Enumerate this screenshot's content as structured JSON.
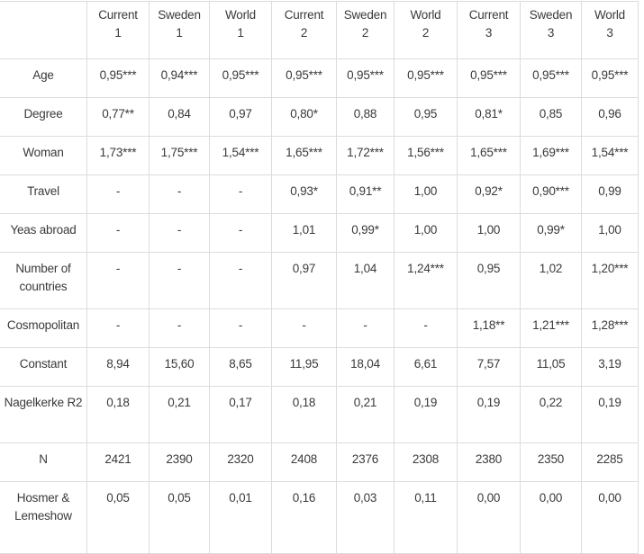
{
  "table": {
    "columns": [
      {
        "name": "Current",
        "model": "1"
      },
      {
        "name": "Sweden",
        "model": "1"
      },
      {
        "name": "World",
        "model": "1"
      },
      {
        "name": "Current",
        "model": "2"
      },
      {
        "name": "Sweden",
        "model": "2"
      },
      {
        "name": "World",
        "model": "2"
      },
      {
        "name": "Current",
        "model": "3"
      },
      {
        "name": "Sweden",
        "model": "3"
      },
      {
        "name": "World",
        "model": "3"
      }
    ],
    "rows": [
      {
        "label": "Age",
        "values": [
          "0,95***",
          "0,94***",
          "0,95***",
          "0,95***",
          "0,95***",
          "0,95***",
          "0,95***",
          "0,95***",
          "0,95***"
        ]
      },
      {
        "label": "Degree",
        "values": [
          "0,77**",
          "0,84",
          "0,97",
          "0,80*",
          "0,88",
          "0,95",
          "0,81*",
          "0,85",
          "0,96"
        ]
      },
      {
        "label": "Woman",
        "values": [
          "1,73***",
          "1,75***",
          "1,54***",
          "1,65***",
          "1,72***",
          "1,56***",
          "1,65***",
          "1,69***",
          "1,54***"
        ]
      },
      {
        "label": "Travel",
        "values": [
          "-",
          "-",
          "-",
          "0,93*",
          "0,91**",
          "1,00",
          "0,92*",
          "0,90***",
          "0,99"
        ]
      },
      {
        "label": "Yeas abroad",
        "values": [
          "-",
          "-",
          "-",
          "1,01",
          "0,99*",
          "1,00",
          "1,00",
          "0,99*",
          "1,00"
        ]
      },
      {
        "label": "Number of countries",
        "values": [
          "-",
          "-",
          "-",
          "0,97",
          "1,04",
          "1,24***",
          "0,95",
          "1,02",
          "1,20***"
        ]
      },
      {
        "label": "Cosmopolitan",
        "values": [
          "-",
          "-",
          "-",
          "-",
          "-",
          "-",
          "1,18**",
          "1,21***",
          "1,28***"
        ]
      },
      {
        "label": "Constant",
        "values": [
          "8,94",
          "15,60",
          "8,65",
          "11,95",
          "18,04",
          "6,61",
          "7,57",
          "11,05",
          "3,19"
        ]
      },
      {
        "label": "Nagelkerke R2",
        "values": [
          "0,18",
          "0,21",
          "0,17",
          "0,18",
          "0,21",
          "0,19",
          "0,19",
          "0,22",
          "0,19"
        ]
      },
      {
        "label": "N",
        "values": [
          "2421",
          "2390",
          "2320",
          "2408",
          "2376",
          "2308",
          "2380",
          "2350",
          "2285"
        ]
      },
      {
        "label": "Hosmer & Lemeshow",
        "values": [
          "0,05",
          "0,05",
          "0,01",
          "0,16",
          "0,03",
          "0,11",
          "0,00",
          "0,00",
          "0,00"
        ]
      }
    ]
  }
}
